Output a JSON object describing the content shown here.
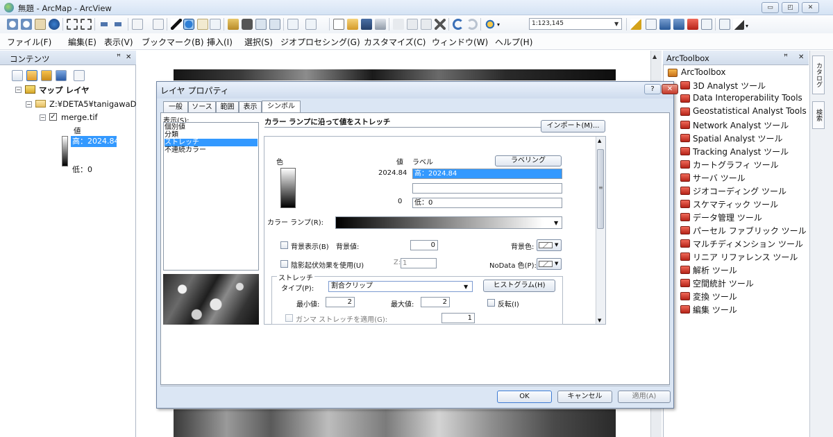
{
  "window": {
    "title": "無題 - ArcMap - ArcView",
    "min": "▭",
    "max": "◰",
    "close": "✕"
  },
  "toolbar": {
    "scale": "1:123,145"
  },
  "menu": [
    "ファイル(F)",
    "編集(E)",
    "表示(V)",
    "ブックマーク(B)",
    "挿入(I)",
    "選択(S)",
    "ジオプロセシング(G)",
    "カスタマイズ(C)",
    "ウィンドウ(W)",
    "ヘルプ(H)"
  ],
  "toc": {
    "title": "コンテンツ",
    "pin": "ꟸ",
    "close": "✕",
    "map_layers": "マップ レイヤ",
    "folder": "Z:¥DETA5¥tanigawaDE",
    "layer": "merge.tif",
    "legend_value": "値",
    "legend_high": "高：2024.84",
    "legend_low": "低：0"
  },
  "toolbox": {
    "title": "ArcToolbox",
    "pin": "ꟸ",
    "close": "✕",
    "root": "ArcToolbox",
    "items": [
      "3D Analyst ツール",
      "Data Interoperability Tools",
      "Geostatistical Analyst Tools",
      "Network Analyst ツール",
      "Spatial Analyst ツール",
      "Tracking Analyst ツール",
      "カートグラフィ ツール",
      "サーバ ツール",
      "ジオコーディング ツール",
      "スケマティック ツール",
      "データ管理 ツール",
      "パーセル ファブリック ツール",
      "マルチディメンション ツール",
      "リニア リファレンス ツール",
      "解析 ツール",
      "空間統計 ツール",
      "変換 ツール",
      "編集 ツール"
    ]
  },
  "side_tabs": [
    "カタログ",
    "検索"
  ],
  "dialog": {
    "title": "レイヤ プロパティ",
    "help": "?",
    "close": "✕",
    "tabs": [
      "一般",
      "ソース",
      "範囲",
      "表示",
      "シンボル"
    ],
    "active_tab": "シンボル",
    "show_label": "表示(S):",
    "show_items": [
      "個別値",
      "分類",
      "ストレッチ",
      "不連続カラー"
    ],
    "selected_show": "ストレッチ",
    "description": "カラー ランプに沿って値をストレッチ",
    "import_button": "インポート(M)...",
    "col_color": "色",
    "col_value": "値",
    "col_label": "ラベル",
    "labeling_button": "ラベリング",
    "high_value": "2024.84",
    "high_label": "高：2024.84",
    "low_value": "0",
    "low_label": "低：0",
    "color_ramp_label": "カラー ランプ(R):",
    "background_checkbox": "背景表示(B)",
    "background_value_label": "背景値:",
    "background_value": "0",
    "background_color_label": "背景色:",
    "hillshade_checkbox": "陰影起伏効果を使用(U)",
    "z_label": "Z:",
    "z_value": "1",
    "nodata_label": "NoData 色(P):",
    "stretch_group": "ストレッチ",
    "type_label": "タイプ(P):",
    "type_value": "割合クリップ",
    "histogram_button": "ヒストグラム(H)",
    "min_label": "最小値:",
    "min_value": "2",
    "max_label": "最大値:",
    "max_value": "2",
    "invert_checkbox": "反転(I)",
    "gamma_checkbox": "ガンマ ストレッチを適用(G):",
    "gamma_value": "1",
    "ok": "OK",
    "cancel": "キャンセル",
    "apply": "適用(A)"
  }
}
